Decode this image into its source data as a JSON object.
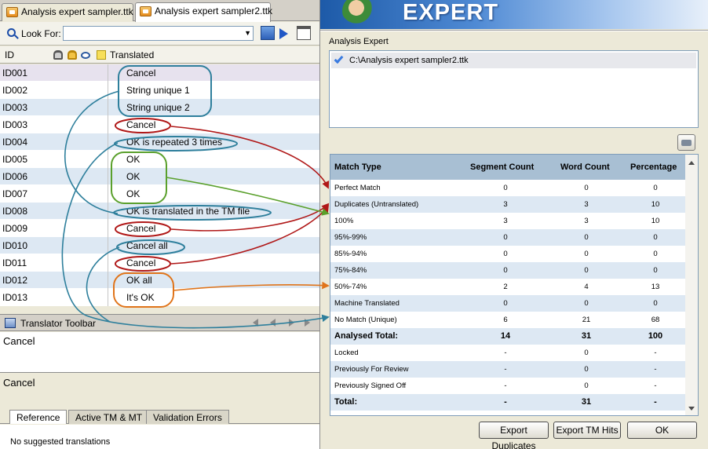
{
  "editor": {
    "tabs": [
      {
        "label": "Analysis expert sampler.ttk"
      },
      {
        "label": "Analysis expert sampler2.ttk"
      }
    ],
    "look_for_label": "Look For:",
    "look_for_value": "",
    "grid_headers": {
      "id": "ID",
      "translated": "Translated"
    },
    "rows": [
      {
        "id": "ID001",
        "text": "Cancel"
      },
      {
        "id": "ID002",
        "text": "String unique 1"
      },
      {
        "id": "ID003",
        "text": "String unique 2"
      },
      {
        "id": "ID003",
        "text": "Cancel"
      },
      {
        "id": "ID004",
        "text": "OK is repeated 3 times"
      },
      {
        "id": "ID005",
        "text": "OK"
      },
      {
        "id": "ID006",
        "text": "OK"
      },
      {
        "id": "ID007",
        "text": "OK"
      },
      {
        "id": "ID008",
        "text": "OK is translated in the TM file"
      },
      {
        "id": "ID009",
        "text": "Cancel"
      },
      {
        "id": "ID010",
        "text": "Cancel all"
      },
      {
        "id": "ID011",
        "text": "Cancel"
      },
      {
        "id": "ID012",
        "text": "OK all"
      },
      {
        "id": "ID013",
        "text": "It's OK"
      }
    ],
    "translator_toolbar_label": "Translator Toolbar",
    "source_text": "Cancel",
    "target_text": "Cancel",
    "bottom_tabs": [
      {
        "label": "Reference"
      },
      {
        "label": "Active TM & MT"
      },
      {
        "label": "Validation Errors"
      }
    ],
    "suggestion_text": "No suggested translations"
  },
  "analysis": {
    "banner_text": "EXPERT",
    "section_label": "Analysis Expert",
    "file": "C:\\Analysis expert sampler2.ttk",
    "headers": {
      "type": "Match Type",
      "segments": "Segment Count",
      "words": "Word Count",
      "percent": "Percentage"
    },
    "rows": [
      {
        "type": "Perfect Match",
        "segments": "0",
        "words": "0",
        "percent": "0"
      },
      {
        "type": "Duplicates (Untranslated)",
        "segments": "3",
        "words": "3",
        "percent": "10"
      },
      {
        "type": "100%",
        "segments": "3",
        "words": "3",
        "percent": "10"
      },
      {
        "type": "95%-99%",
        "segments": "0",
        "words": "0",
        "percent": "0"
      },
      {
        "type": "85%-94%",
        "segments": "0",
        "words": "0",
        "percent": "0"
      },
      {
        "type": "75%-84%",
        "segments": "0",
        "words": "0",
        "percent": "0"
      },
      {
        "type": "50%-74%",
        "segments": "2",
        "words": "4",
        "percent": "13"
      },
      {
        "type": "Machine Translated",
        "segments": "0",
        "words": "0",
        "percent": "0"
      },
      {
        "type": "No Match (Unique)",
        "segments": "6",
        "words": "21",
        "percent": "68"
      },
      {
        "type": "Analysed Total:",
        "segments": "14",
        "words": "31",
        "percent": "100"
      },
      {
        "type": "Locked",
        "segments": "-",
        "words": "0",
        "percent": "-"
      },
      {
        "type": "Previously For Review",
        "segments": "-",
        "words": "0",
        "percent": "-"
      },
      {
        "type": "Previously Signed Off",
        "segments": "-",
        "words": "0",
        "percent": "-"
      },
      {
        "type": "Total:",
        "segments": "-",
        "words": "31",
        "percent": "-"
      }
    ],
    "buttons": {
      "export_duplicates": "Export Duplicates",
      "export_tm_hits": "Export TM Hits",
      "ok": "OK"
    }
  },
  "colors": {
    "teal_annotation": "#2e7f9c",
    "red_annotation": "#b01818",
    "green_annotation": "#5aa02c",
    "orange_annotation": "#e0741a",
    "grid_row_alt": "#dde8f3",
    "table_header": "#a8bfd3"
  }
}
